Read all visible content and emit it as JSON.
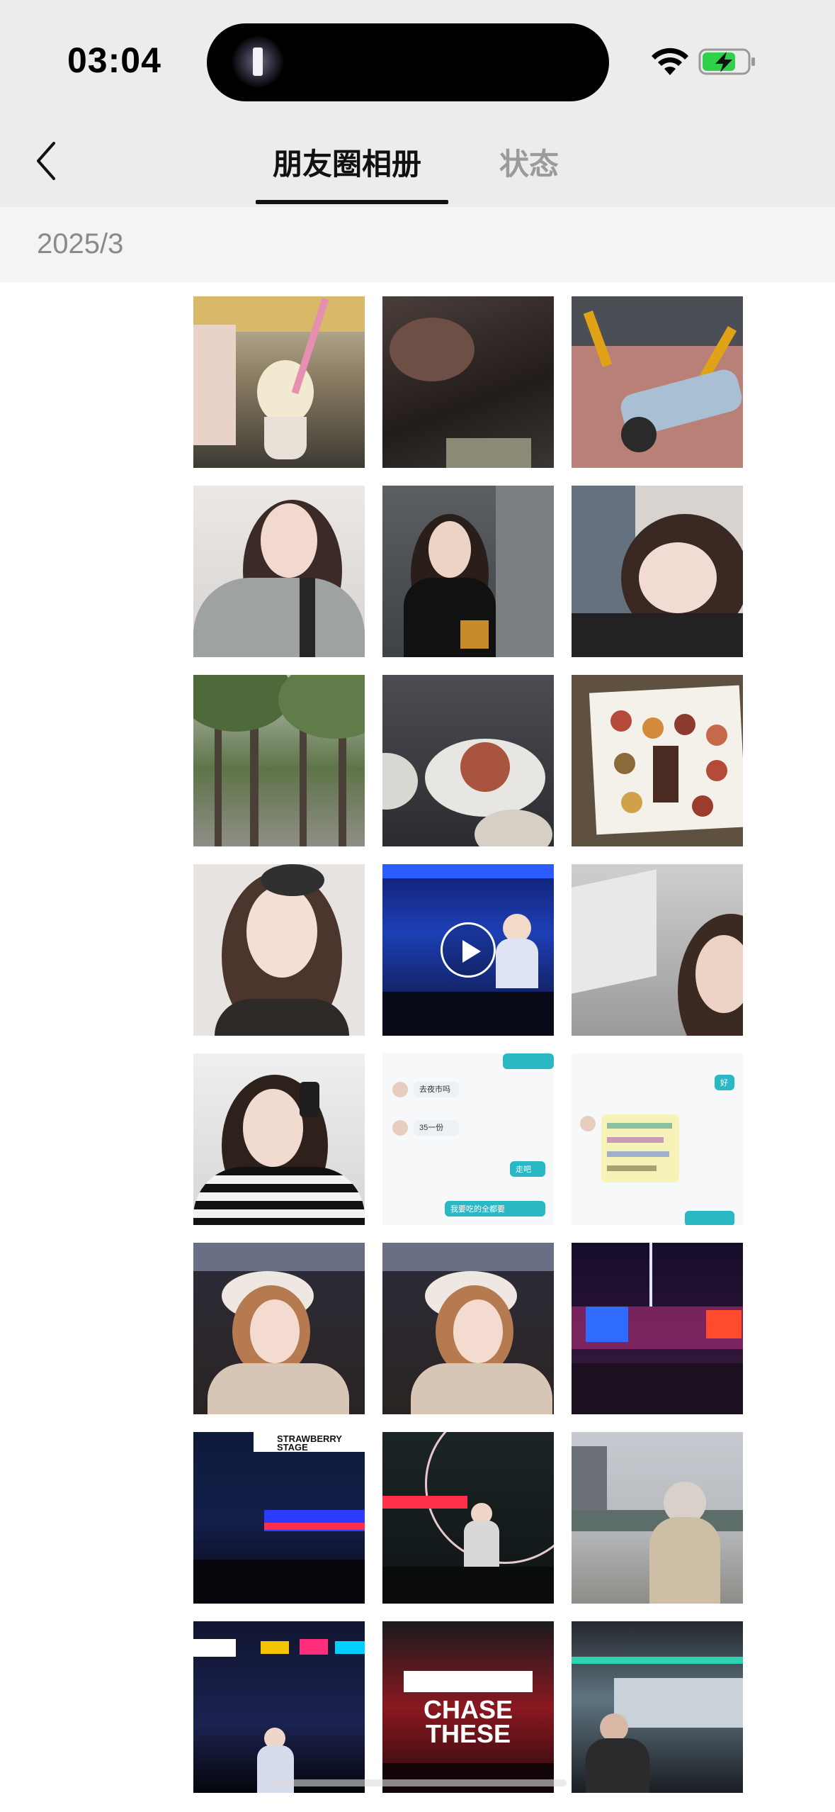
{
  "status_bar": {
    "time": "03:04"
  },
  "icons": {
    "back": "chevron-left-icon",
    "wifi": "wifi-icon",
    "battery": "battery-charging-icon",
    "flashlight": "flashlight-icon",
    "play": "play-icon"
  },
  "header": {
    "tabs": [
      {
        "label": "朋友圈相册",
        "selected": true
      },
      {
        "label": "状态",
        "selected": false
      }
    ]
  },
  "album": {
    "date": "2025/3",
    "photos": [
      {
        "subject": "ice-cream",
        "is_video": false
      },
      {
        "subject": "dim-cafe",
        "is_video": false
      },
      {
        "subject": "street-legs",
        "is_video": false
      },
      {
        "subject": "selfie-gray-sweater",
        "is_video": false
      },
      {
        "subject": "mirror-selfie-hallway",
        "is_video": false
      },
      {
        "subject": "selfie-lying",
        "is_video": false
      },
      {
        "subject": "trees",
        "is_video": false
      },
      {
        "subject": "food-plate",
        "is_video": false
      },
      {
        "subject": "food-poster",
        "is_video": false
      },
      {
        "subject": "portrait-sunglasses",
        "is_video": false
      },
      {
        "subject": "concert-stage",
        "is_video": true
      },
      {
        "subject": "side-face",
        "is_video": false
      },
      {
        "subject": "mirror-selfie-striped",
        "is_video": false
      },
      {
        "subject": "chat-screenshot-1",
        "is_video": false
      },
      {
        "subject": "chat-screenshot-2",
        "is_video": false
      },
      {
        "subject": "festival-hat-1",
        "is_video": false
      },
      {
        "subject": "festival-hat-2",
        "is_video": false
      },
      {
        "subject": "festival-neon",
        "is_video": false
      },
      {
        "subject": "strawberry-stage",
        "is_video": false
      },
      {
        "subject": "stage-guitar",
        "is_video": false
      },
      {
        "subject": "festival-crowd-day",
        "is_video": false
      },
      {
        "subject": "concert-lights",
        "is_video": false
      },
      {
        "subject": "chase-these-stage",
        "is_video": false
      },
      {
        "subject": "guitarist-stage",
        "is_video": false
      }
    ],
    "texts": {
      "strawberry_stage": "STRAWBERRY STAGE",
      "chase_these": "CHASE THESE",
      "chat_1_line_1": "去夜市吗",
      "chat_1_line_2": "35一份",
      "chat_1_reply_1": "走吧",
      "chat_1_reply_2": "我要吃的全都要",
      "chat_2_note": "好"
    }
  },
  "colors": {
    "accent_chat": "#2ab8c5",
    "tab_inactive": "#9b9b9b",
    "battery_green": "#2fd14a"
  }
}
